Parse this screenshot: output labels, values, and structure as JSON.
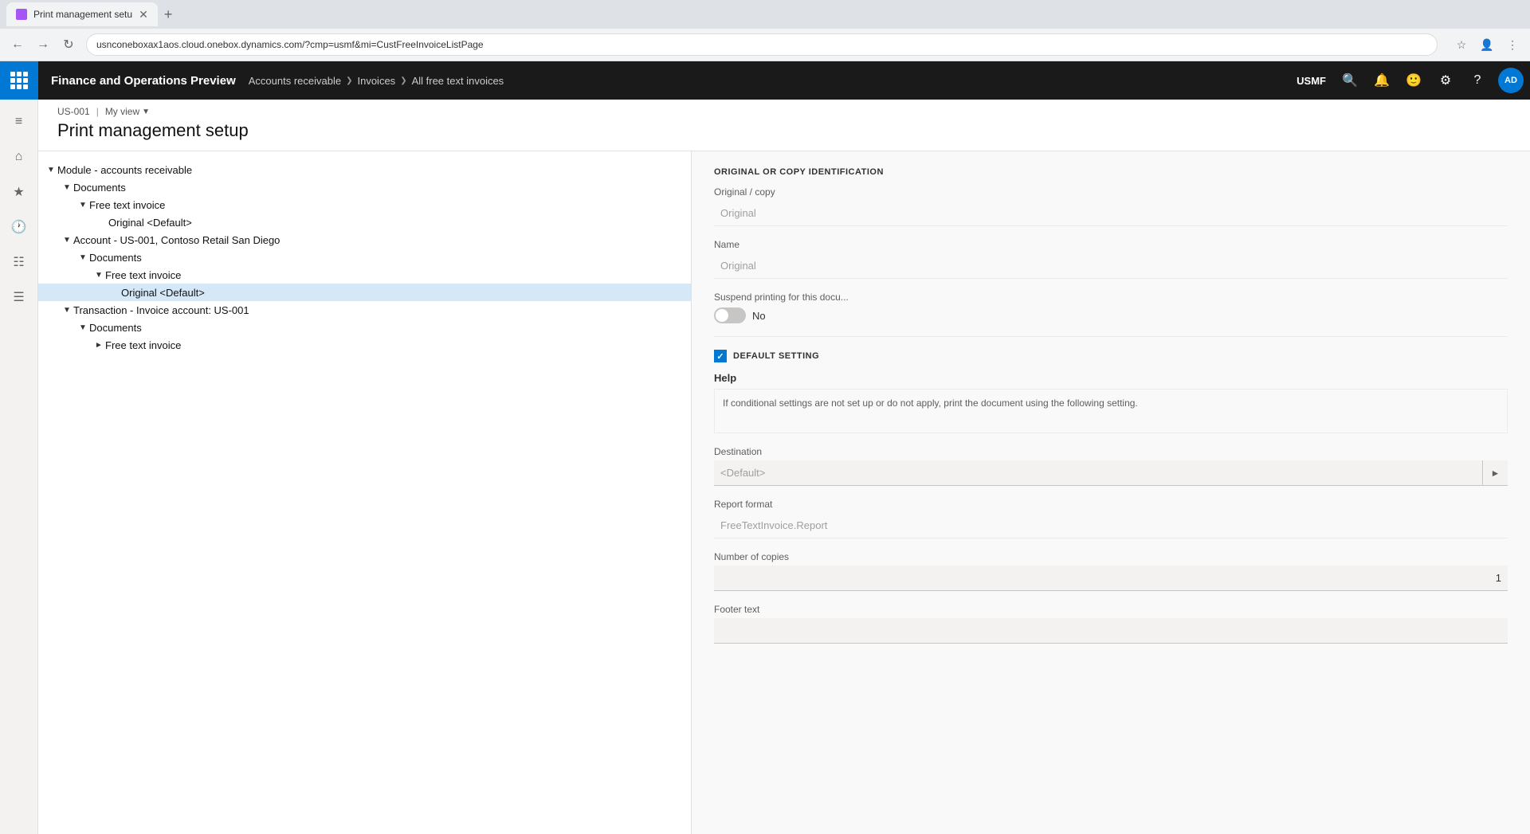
{
  "browser": {
    "tab_title": "Print management setu",
    "url": "usnconeboxax1aos.cloud.onebox.dynamics.com/?cmp=usmf&mi=CustFreeInvoiceListPage",
    "new_tab_label": "+",
    "back_disabled": false,
    "forward_disabled": false
  },
  "header": {
    "app_title": "Finance and Operations Preview",
    "entity": "USMF",
    "breadcrumb": [
      {
        "label": "Accounts receivable"
      },
      {
        "label": "Invoices"
      },
      {
        "label": "All free text invoices"
      }
    ],
    "avatar": "AD"
  },
  "page": {
    "meta_id": "US-001",
    "meta_sep": "|",
    "meta_view": "My view",
    "title": "Print management setup"
  },
  "sidebar": {
    "filter_icon": "⊟",
    "home_icon": "⌂",
    "star_icon": "☆",
    "clock_icon": "🕐",
    "calendar_icon": "▦",
    "list_icon": "☰"
  },
  "tree": {
    "items": [
      {
        "id": "module",
        "label": "Module - accounts receivable",
        "indent": 0,
        "arrow": "▼",
        "selected": false
      },
      {
        "id": "docs1",
        "label": "Documents",
        "indent": 1,
        "arrow": "▼",
        "selected": false
      },
      {
        "id": "fti1",
        "label": "Free text invoice",
        "indent": 2,
        "arrow": "▼",
        "selected": false
      },
      {
        "id": "orig1",
        "label": "Original <Default>",
        "indent": 3,
        "arrow": "",
        "selected": false
      },
      {
        "id": "account",
        "label": "Account - US-001, Contoso Retail San Diego",
        "indent": 1,
        "arrow": "▼",
        "selected": false
      },
      {
        "id": "docs2",
        "label": "Documents",
        "indent": 2,
        "arrow": "▼",
        "selected": false
      },
      {
        "id": "fti2",
        "label": "Free text invoice",
        "indent": 3,
        "arrow": "▼",
        "selected": false
      },
      {
        "id": "orig2",
        "label": "Original <Default>",
        "indent": 4,
        "arrow": "",
        "selected": true
      },
      {
        "id": "transaction",
        "label": "Transaction - Invoice account: US-001",
        "indent": 1,
        "arrow": "▼",
        "selected": false
      },
      {
        "id": "docs3",
        "label": "Documents",
        "indent": 2,
        "arrow": "▼",
        "selected": false
      },
      {
        "id": "fti3",
        "label": "Free text invoice",
        "indent": 3,
        "arrow": "▶",
        "selected": false
      }
    ]
  },
  "detail": {
    "section_title": "ORIGINAL OR COPY IDENTIFICATION",
    "original_copy_label": "Original / copy",
    "original_copy_value": "Original",
    "name_label": "Name",
    "name_value": "Original",
    "suspend_label": "Suspend printing for this docu...",
    "suspend_value": false,
    "suspend_text": "No",
    "default_setting_label": "DEFAULT SETTING",
    "help_label": "Help",
    "help_text": "If conditional settings are not set up or do not apply, print the document using the following setting.",
    "destination_label": "Destination",
    "destination_value": "<Default>",
    "report_format_label": "Report format",
    "report_format_value": "FreeTextInvoice.Report",
    "copies_label": "Number of copies",
    "copies_value": "1",
    "footer_label": "Footer text"
  }
}
